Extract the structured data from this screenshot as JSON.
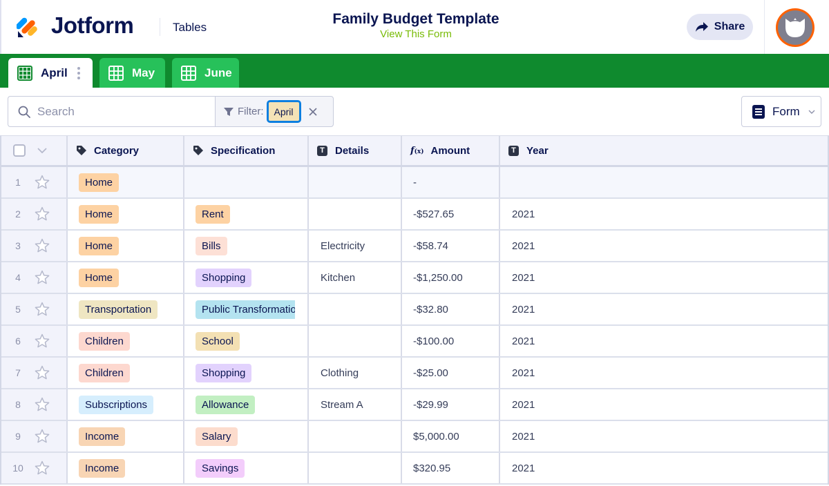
{
  "header": {
    "brand": "Jotform",
    "app_name": "Tables",
    "title": "Family Budget Template",
    "view_form_link": "View This Form",
    "share_label": "Share",
    "avatar_icon": "cat-avatar-icon"
  },
  "tabs": [
    {
      "label": "April",
      "active": true,
      "icon": "table-grid-icon"
    },
    {
      "label": "May",
      "active": false,
      "icon": "table-grid-icon"
    },
    {
      "label": "June",
      "active": false,
      "icon": "table-grid-icon"
    }
  ],
  "toolbar": {
    "search_placeholder": "Search",
    "search_value": "",
    "filter_label": "Filter:",
    "filter_value": "April",
    "form_button_label": "Form"
  },
  "colors": {
    "brand_navy": "#0a1551",
    "tabbar_green": "#0f8a2e",
    "tab_inactive_green": "#27c15a",
    "link_green": "#78bb07",
    "avatar_ring": "#ff6100",
    "filter_focus": "#0d7fe0"
  },
  "table": {
    "columns": [
      {
        "label": "Category",
        "icon": "tag-icon"
      },
      {
        "label": "Specification",
        "icon": "tag-icon"
      },
      {
        "label": "Details",
        "icon": "text-type-icon"
      },
      {
        "label": "Amount",
        "icon": "formula-icon"
      },
      {
        "label": "Year",
        "icon": "text-type-icon"
      }
    ],
    "rows": [
      {
        "num": "1",
        "category": "Home",
        "category_color": "#fdd2a3",
        "specification": "",
        "spec_color": "",
        "details": "",
        "amount": "-",
        "year": ""
      },
      {
        "num": "2",
        "category": "Home",
        "category_color": "#fdd2a3",
        "specification": "Rent",
        "spec_color": "#fdd2a3",
        "details": "",
        "amount": "-$527.65",
        "year": "2021"
      },
      {
        "num": "3",
        "category": "Home",
        "category_color": "#fdd2a3",
        "specification": "Bills",
        "spec_color": "#fde0d6",
        "details": "Electricity",
        "amount": "-$58.74",
        "year": "2021"
      },
      {
        "num": "4",
        "category": "Home",
        "category_color": "#fdd2a3",
        "specification": "Shopping",
        "spec_color": "#e2d2fd",
        "details": "Kitchen",
        "amount": "-$1,250.00",
        "year": "2021"
      },
      {
        "num": "5",
        "category": "Transportation",
        "category_color": "#efe6c2",
        "specification": "Public Transformation",
        "spec_color": "#b4e3f0",
        "details": "",
        "amount": "-$32.80",
        "year": "2021"
      },
      {
        "num": "6",
        "category": "Children",
        "category_color": "#fdd8cf",
        "specification": "School",
        "spec_color": "#f3e0b3",
        "details": "",
        "amount": "-$100.00",
        "year": "2021"
      },
      {
        "num": "7",
        "category": "Children",
        "category_color": "#fdd8cf",
        "specification": "Shopping",
        "spec_color": "#e2d2fd",
        "details": "Clothing",
        "amount": "-$25.00",
        "year": "2021"
      },
      {
        "num": "8",
        "category": "Subscriptions",
        "category_color": "#d6eefd",
        "specification": "Allowance",
        "spec_color": "#c2efc2",
        "details": "Stream A",
        "amount": "-$29.99",
        "year": "2021"
      },
      {
        "num": "9",
        "category": "Income",
        "category_color": "#f8d5b4",
        "specification": "Salary",
        "spec_color": "#fcdccd",
        "details": "",
        "amount": "$5,000.00",
        "year": "2021"
      },
      {
        "num": "10",
        "category": "Income",
        "category_color": "#f8d5b4",
        "specification": "Savings",
        "spec_color": "#f3cdfb",
        "details": "",
        "amount": "$320.95",
        "year": "2021"
      }
    ]
  }
}
